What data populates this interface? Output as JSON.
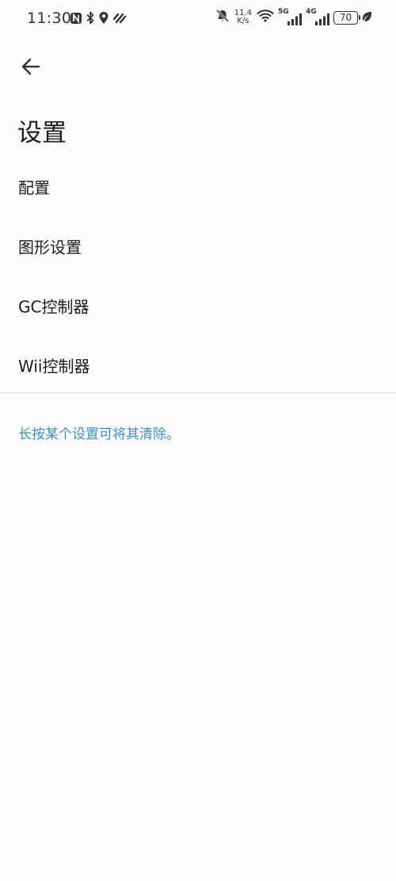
{
  "status_bar": {
    "time": "11:30",
    "speed_value": "11.4",
    "speed_unit": "K/s",
    "network_1": "5G",
    "network_2": "4G",
    "battery": "70"
  },
  "header": {
    "back_icon": "arrow-left-icon",
    "title": "设置"
  },
  "settings": {
    "items": [
      {
        "label": "配置"
      },
      {
        "label": "图形设置"
      },
      {
        "label": "GC控制器"
      },
      {
        "label": "Wii控制器"
      }
    ]
  },
  "hint": "长按某个设置可将其清除。",
  "colors": {
    "background": "#fcfcfe",
    "text": "#1c1c1e",
    "accent": "#3d8fc9",
    "divider": "#dcdce0"
  }
}
